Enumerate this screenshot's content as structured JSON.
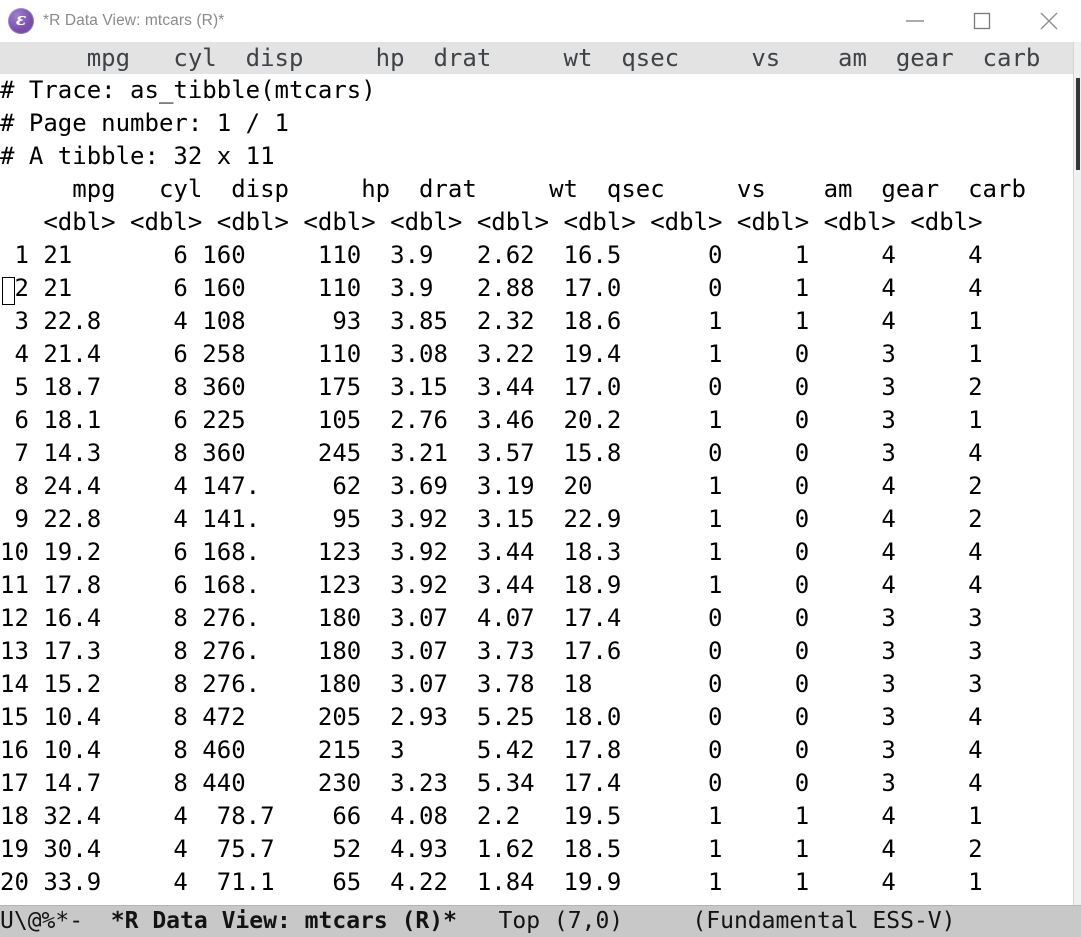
{
  "window": {
    "title": "*R Data View: mtcars (R)*",
    "app_icon": "emacs-icon",
    "icon_glyph": "ε",
    "controls": {
      "minimize": "minimize-icon",
      "maximize": "maximize-icon",
      "close": "close-icon"
    }
  },
  "sticky_header": {
    "text": "      mpg   cyl  disp     hp  drat     wt  qsec     vs    am  gear  carb"
  },
  "buffer": {
    "trace_line": "# Trace: as_tibble(mtcars)",
    "page_line": "# Page number: 1 / 1",
    "tibble_line": "# A tibble: 32 x 11",
    "column_header": "     mpg   cyl  disp     hp  drat     wt  qsec     vs    am  gear  carb",
    "dtype_row": "   <dbl> <dbl> <dbl> <dbl> <dbl> <dbl> <dbl> <dbl> <dbl> <dbl> <dbl>",
    "columns": [
      "mpg",
      "cyl",
      "disp",
      "hp",
      "drat",
      "wt",
      "qsec",
      "vs",
      "am",
      "gear",
      "carb"
    ],
    "dtypes": [
      "<dbl>",
      "<dbl>",
      "<dbl>",
      "<dbl>",
      "<dbl>",
      "<dbl>",
      "<dbl>",
      "<dbl>",
      "<dbl>",
      "<dbl>",
      "<dbl>"
    ],
    "rows": [
      " 1 21       6 160     110  3.9   2.62  16.5      0     1     4     4",
      " 2 21       6 160     110  3.9   2.88  17.0      0     1     4     4",
      " 3 22.8     4 108      93  3.85  2.32  18.6      1     1     4     1",
      " 4 21.4     6 258     110  3.08  3.22  19.4      1     0     3     1",
      " 5 18.7     8 360     175  3.15  3.44  17.0      0     0     3     2",
      " 6 18.1     6 225     105  2.76  3.46  20.2      1     0     3     1",
      " 7 14.3     8 360     245  3.21  3.57  15.8      0     0     3     4",
      " 8 24.4     4 147.     62  3.69  3.19  20        1     0     4     2",
      " 9 22.8     4 141.     95  3.92  3.15  22.9      1     0     4     2",
      "10 19.2     6 168.    123  3.92  3.44  18.3      1     0     4     4",
      "11 17.8     6 168.    123  3.92  3.44  18.9      1     0     4     4",
      "12 16.4     8 276.    180  3.07  4.07  17.4      0     0     3     3",
      "13 17.3     8 276.    180  3.07  3.73  17.6      0     0     3     3",
      "14 15.2     8 276.    180  3.07  3.78  18        0     0     3     3",
      "15 10.4     8 472     205  2.93  5.25  18.0      0     0     3     4",
      "16 10.4     8 460     215  3     5.42  17.8      0     0     3     4",
      "17 14.7     8 440     230  3.23  5.34  17.4      0     0     3     4",
      "18 32.4     4  78.7    66  4.08  2.2   19.5      1     1     4     1",
      "19 30.4     4  75.7    52  4.93  1.62  18.5      1     1     4     2",
      "20 33.9     4  71.1    65  4.22  1.84  19.9      1     1     4     1"
    ],
    "table_data": [
      {
        "n": "1",
        "mpg": "21",
        "cyl": "6",
        "disp": "160",
        "hp": "110",
        "drat": "3.9",
        "wt": "2.62",
        "qsec": "16.5",
        "vs": "0",
        "am": "1",
        "gear": "4",
        "carb": "4"
      },
      {
        "n": "2",
        "mpg": "21",
        "cyl": "6",
        "disp": "160",
        "hp": "110",
        "drat": "3.9",
        "wt": "2.88",
        "qsec": "17.0",
        "vs": "0",
        "am": "1",
        "gear": "4",
        "carb": "4"
      },
      {
        "n": "3",
        "mpg": "22.8",
        "cyl": "4",
        "disp": "108",
        "hp": "93",
        "drat": "3.85",
        "wt": "2.32",
        "qsec": "18.6",
        "vs": "1",
        "am": "1",
        "gear": "4",
        "carb": "1"
      },
      {
        "n": "4",
        "mpg": "21.4",
        "cyl": "6",
        "disp": "258",
        "hp": "110",
        "drat": "3.08",
        "wt": "3.22",
        "qsec": "19.4",
        "vs": "1",
        "am": "0",
        "gear": "3",
        "carb": "1"
      },
      {
        "n": "5",
        "mpg": "18.7",
        "cyl": "8",
        "disp": "360",
        "hp": "175",
        "drat": "3.15",
        "wt": "3.44",
        "qsec": "17.0",
        "vs": "0",
        "am": "0",
        "gear": "3",
        "carb": "2"
      },
      {
        "n": "6",
        "mpg": "18.1",
        "cyl": "6",
        "disp": "225",
        "hp": "105",
        "drat": "2.76",
        "wt": "3.46",
        "qsec": "20.2",
        "vs": "1",
        "am": "0",
        "gear": "3",
        "carb": "1"
      },
      {
        "n": "7",
        "mpg": "14.3",
        "cyl": "8",
        "disp": "360",
        "hp": "245",
        "drat": "3.21",
        "wt": "3.57",
        "qsec": "15.8",
        "vs": "0",
        "am": "0",
        "gear": "3",
        "carb": "4"
      },
      {
        "n": "8",
        "mpg": "24.4",
        "cyl": "4",
        "disp": "147.",
        "hp": "62",
        "drat": "3.69",
        "wt": "3.19",
        "qsec": "20",
        "vs": "1",
        "am": "0",
        "gear": "4",
        "carb": "2"
      },
      {
        "n": "9",
        "mpg": "22.8",
        "cyl": "4",
        "disp": "141.",
        "hp": "95",
        "drat": "3.92",
        "wt": "3.15",
        "qsec": "22.9",
        "vs": "1",
        "am": "0",
        "gear": "4",
        "carb": "2"
      },
      {
        "n": "10",
        "mpg": "19.2",
        "cyl": "6",
        "disp": "168.",
        "hp": "123",
        "drat": "3.92",
        "wt": "3.44",
        "qsec": "18.3",
        "vs": "1",
        "am": "0",
        "gear": "4",
        "carb": "4"
      },
      {
        "n": "11",
        "mpg": "17.8",
        "cyl": "6",
        "disp": "168.",
        "hp": "123",
        "drat": "3.92",
        "wt": "3.44",
        "qsec": "18.9",
        "vs": "1",
        "am": "0",
        "gear": "4",
        "carb": "4"
      },
      {
        "n": "12",
        "mpg": "16.4",
        "cyl": "8",
        "disp": "276.",
        "hp": "180",
        "drat": "3.07",
        "wt": "4.07",
        "qsec": "17.4",
        "vs": "0",
        "am": "0",
        "gear": "3",
        "carb": "3"
      },
      {
        "n": "13",
        "mpg": "17.3",
        "cyl": "8",
        "disp": "276.",
        "hp": "180",
        "drat": "3.07",
        "wt": "3.73",
        "qsec": "17.6",
        "vs": "0",
        "am": "0",
        "gear": "3",
        "carb": "3"
      },
      {
        "n": "14",
        "mpg": "15.2",
        "cyl": "8",
        "disp": "276.",
        "hp": "180",
        "drat": "3.07",
        "wt": "3.78",
        "qsec": "18",
        "vs": "0",
        "am": "0",
        "gear": "3",
        "carb": "3"
      },
      {
        "n": "15",
        "mpg": "10.4",
        "cyl": "8",
        "disp": "472",
        "hp": "205",
        "drat": "2.93",
        "wt": "5.25",
        "qsec": "18.0",
        "vs": "0",
        "am": "0",
        "gear": "3",
        "carb": "4"
      },
      {
        "n": "16",
        "mpg": "10.4",
        "cyl": "8",
        "disp": "460",
        "hp": "215",
        "drat": "3",
        "wt": "5.42",
        "qsec": "17.8",
        "vs": "0",
        "am": "0",
        "gear": "3",
        "carb": "4"
      },
      {
        "n": "17",
        "mpg": "14.7",
        "cyl": "8",
        "disp": "440",
        "hp": "230",
        "drat": "3.23",
        "wt": "5.34",
        "qsec": "17.4",
        "vs": "0",
        "am": "0",
        "gear": "3",
        "carb": "4"
      },
      {
        "n": "18",
        "mpg": "32.4",
        "cyl": "4",
        "disp": "78.7",
        "hp": "66",
        "drat": "4.08",
        "wt": "2.2",
        "qsec": "19.5",
        "vs": "1",
        "am": "1",
        "gear": "4",
        "carb": "1"
      },
      {
        "n": "19",
        "mpg": "30.4",
        "cyl": "4",
        "disp": "75.7",
        "hp": "52",
        "drat": "4.93",
        "wt": "1.62",
        "qsec": "18.5",
        "vs": "1",
        "am": "1",
        "gear": "4",
        "carb": "2"
      },
      {
        "n": "20",
        "mpg": "33.9",
        "cyl": "4",
        "disp": "71.1",
        "hp": "65",
        "drat": "4.22",
        "wt": "1.84",
        "qsec": "19.9",
        "vs": "1",
        "am": "1",
        "gear": "4",
        "carb": "1"
      }
    ]
  },
  "modeline": {
    "flags": "U\\@%*-",
    "buffer_name": "*R Data View: mtcars (R)*",
    "position": "Top (7,0)",
    "modes": "(Fundamental ESS-V)",
    "gap1": "  ",
    "gap2": "   ",
    "gap3": "     "
  },
  "colors": {
    "titlebar_bg": "#ffffff",
    "titlebar_text": "#8a8a8a",
    "sticky_header_bg": "#e3e3e3",
    "sticky_header_text": "#3f4347",
    "buffer_bg": "#ffffff",
    "buffer_text": "#000000",
    "modeline_bg": "#c8c8c8",
    "modeline_text": "#131313",
    "icon_purple": "#7b52ab",
    "scrollbar_thumb": "#33373a"
  }
}
